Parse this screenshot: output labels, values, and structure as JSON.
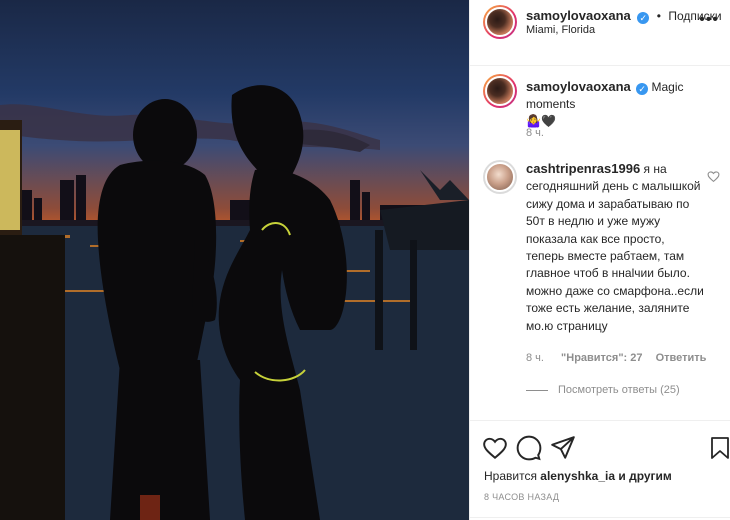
{
  "post_header": {
    "username": "samoylovaoxana",
    "follow_label": "Подписки",
    "location": "Miami, Florida",
    "more_label": "•••"
  },
  "caption": {
    "username": "samoylovaoxana",
    "text": "Magic moments",
    "emoji": "🤷‍♀️🖤",
    "time": "8 ч."
  },
  "comment": {
    "username": "cashtripenras1996",
    "text": "я на сегодняшний день с малышкой сижу дома и зарабатываю по 50т в недлю и уже мужу показала как все просто, теперь вместе рабтаем, там главное чтоб в ннаlчии было. можно даже со смарфона..если тоже есть желание, заляните мо.ю страницу",
    "time": "8 ч.",
    "likes_label": "\"Нравится\": 27",
    "reply_label": "Ответить",
    "view_replies": "Посмотреть ответы (25)"
  },
  "actions": {
    "liked_by_prefix": "Нравится",
    "liked_by_user": "alenyshka_ia",
    "liked_by_suffix": "и другим",
    "time_ago": "8 часов назад"
  },
  "icons": [
    "heart-icon",
    "comment-icon",
    "share-icon",
    "bookmark-icon",
    "verified-icon",
    "more-options-icon"
  ],
  "colors": {
    "verified_blue": "#3897f0",
    "secondary_text": "#8e8e8e",
    "divider": "#efefef"
  }
}
